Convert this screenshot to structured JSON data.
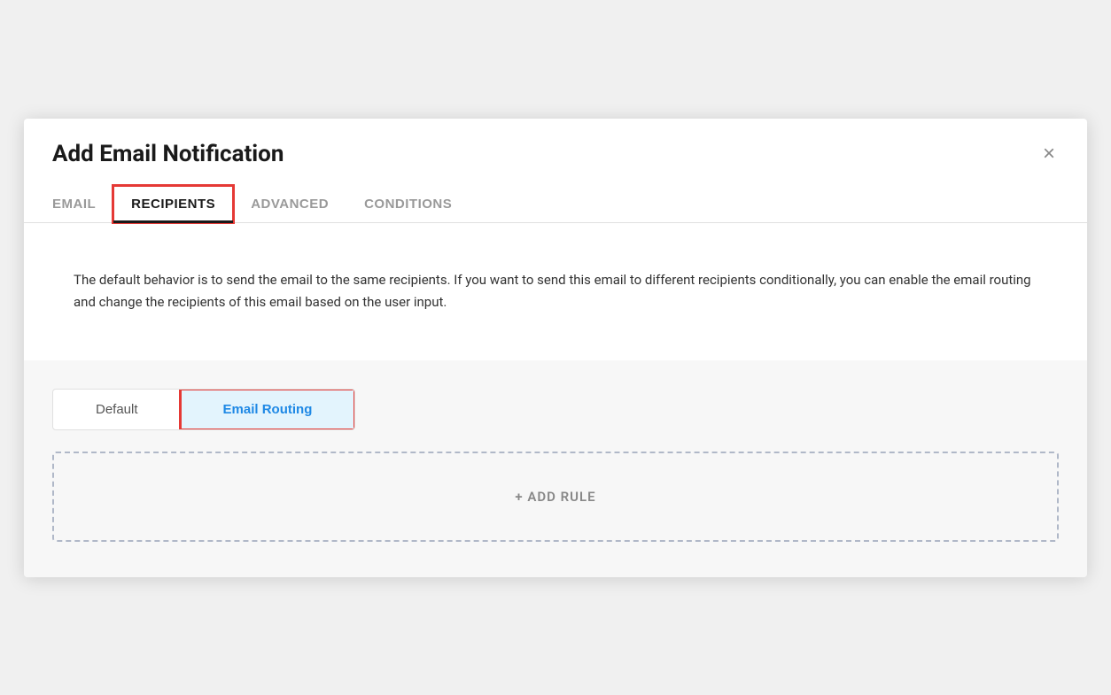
{
  "modal": {
    "title": "Add Email Notification",
    "close_label": "×"
  },
  "tabs": [
    {
      "id": "email",
      "label": "EMAIL",
      "active": false
    },
    {
      "id": "recipients",
      "label": "RECIPIENTS",
      "active": true
    },
    {
      "id": "advanced",
      "label": "ADVANCED",
      "active": false
    },
    {
      "id": "conditions",
      "label": "CONDITIONS",
      "active": false
    }
  ],
  "body": {
    "description": "The default behavior is to send the email to the same recipients. If you want to send this email to different recipients conditionally, you can enable the email routing and change the recipients of this email based on the user input.",
    "toggle": {
      "default_label": "Default",
      "email_routing_label": "Email Routing",
      "active": "email_routing"
    },
    "add_rule_label": "+ ADD RULE"
  }
}
